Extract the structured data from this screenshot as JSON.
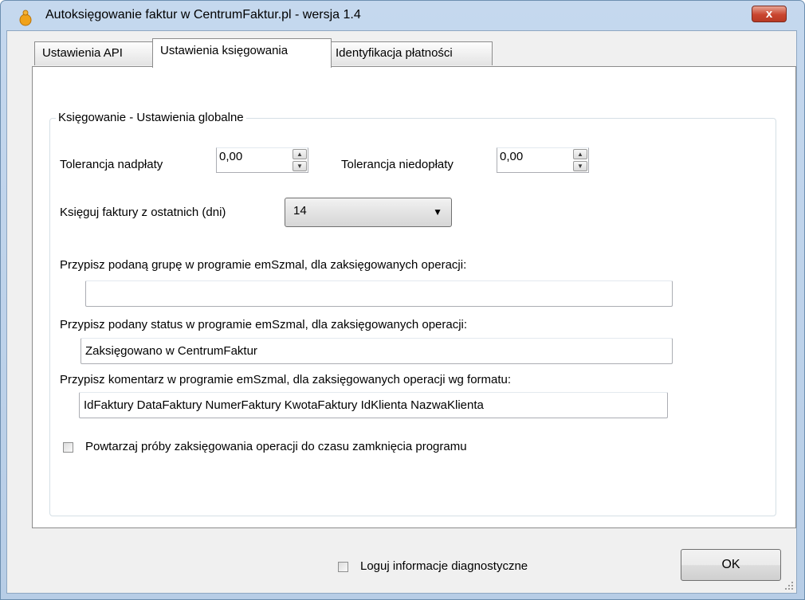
{
  "window": {
    "title": "Autoksięgowanie faktur w CentrumFaktur.pl - wersja 1.4",
    "close_label": "x"
  },
  "tabs": [
    {
      "label": "Ustawienia API",
      "active": false
    },
    {
      "label": "Ustawienia księgowania",
      "active": true
    },
    {
      "label": "Identyfikacja płatności",
      "active": false
    }
  ],
  "group": {
    "title": "Księgowanie - Ustawienia globalne",
    "overpay_label": "Tolerancja nadpłaty",
    "overpay_value": "0,00",
    "underpay_label": "Tolerancja niedopłaty",
    "underpay_value": "0,00",
    "days_label": "Księguj faktury z ostatnich (dni)",
    "days_value": "14",
    "group_label": "Przypisz podaną grupę w programie emSzmal, dla zaksięgowanych operacji:",
    "group_value": "",
    "status_label": "Przypisz podany status w programie emSzmal, dla zaksięgowanych operacji:",
    "status_value": "Zaksięgowano w CentrumFaktur",
    "comment_label": "Przypisz komentarz w programie emSzmal, dla zaksięgowanych operacji wg formatu:",
    "comment_value": "IdFaktury DataFaktury NumerFaktury KwotaFaktury IdKlienta NazwaKlienta",
    "retry_label": "Powtarzaj próby zaksięgowania operacji do czasu zamknięcia programu",
    "retry_checked": false
  },
  "footer": {
    "log_label": "Loguj informacje diagnostyczne",
    "log_checked": false,
    "ok_label": "OK"
  }
}
